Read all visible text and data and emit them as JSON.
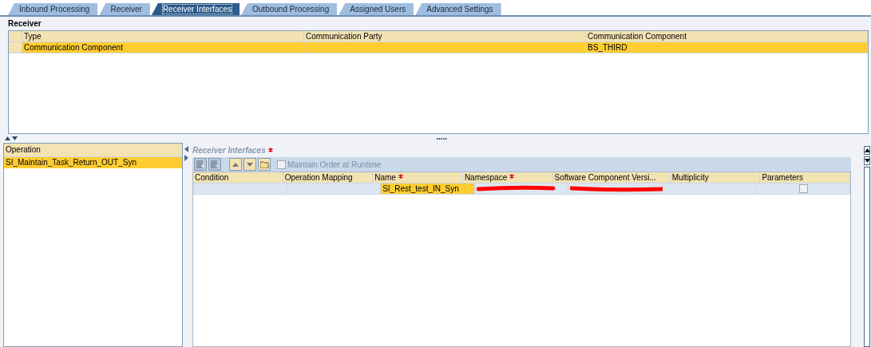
{
  "tabs": [
    {
      "label": "Inbound Processing",
      "selected": false
    },
    {
      "label": "Receiver",
      "selected": false
    },
    {
      "label": "Receiver Interfaces",
      "selected": true
    },
    {
      "label": "Outbound Processing",
      "selected": false
    },
    {
      "label": "Assigned Users",
      "selected": false
    },
    {
      "label": "Advanced Settings",
      "selected": false
    }
  ],
  "receiver": {
    "title": "Receiver",
    "columns": [
      "Type",
      "Communication Party",
      "Communication Component"
    ],
    "rows": [
      {
        "cells": [
          "Communication Component",
          "",
          "BS_THIRD"
        ],
        "selected": true
      }
    ]
  },
  "operations": {
    "column": "Operation",
    "rows": [
      {
        "label": "SI_Maintain_Task_Return_OUT_Syn",
        "selected": true
      }
    ]
  },
  "receiver_interfaces": {
    "title": "Receiver Interfaces",
    "required": true,
    "maintain_order": {
      "label": "Maintain Order at Runtime",
      "checked": false,
      "disabled": true
    },
    "columns": [
      {
        "label": "Condition",
        "required": false
      },
      {
        "label": "Operation Mapping",
        "required": false
      },
      {
        "label": "Name",
        "required": true
      },
      {
        "label": "Namespace",
        "required": true
      },
      {
        "label": "Software Component Versi...",
        "required": false
      },
      {
        "label": "Multiplicity",
        "required": false
      },
      {
        "label": "Parameters",
        "required": false
      }
    ],
    "rows": [
      {
        "name": "SI_Rest_test_IN_Syn",
        "name_selected": true,
        "namespace_redacted": true,
        "swcv_redacted": true,
        "parameters_checked": false
      }
    ]
  }
}
